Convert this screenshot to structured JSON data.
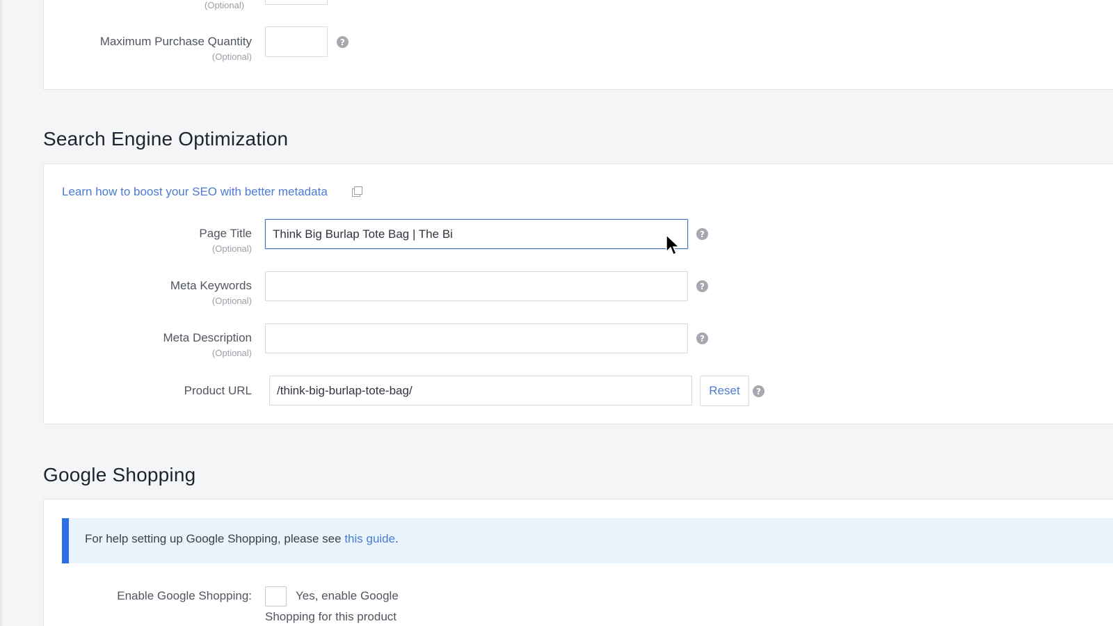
{
  "purchase": {
    "top_optional": "(Optional)",
    "max_qty_label": "Maximum Purchase Quantity",
    "max_qty_optional": "(Optional)",
    "max_qty_value": ""
  },
  "seo": {
    "title": "Search Engine Optimization",
    "learn_link": "Learn how to boost your SEO with better metadata",
    "page_title_label": "Page Title",
    "page_title_optional": "(Optional)",
    "page_title_value": "Think Big Burlap Tote Bag | The Bi",
    "meta_keywords_label": "Meta Keywords",
    "meta_keywords_optional": "(Optional)",
    "meta_keywords_value": "",
    "meta_description_label": "Meta Description",
    "meta_description_optional": "(Optional)",
    "meta_description_value": "",
    "product_url_label": "Product URL",
    "product_url_value": "/think-big-burlap-tote-bag/",
    "reset_label": "Reset",
    "help_glyph": "?"
  },
  "google": {
    "title": "Google Shopping",
    "info_prefix": "For help setting up Google Shopping, please see ",
    "info_link": "this guide",
    "info_suffix": ".",
    "enable_label": "Enable Google Shopping:",
    "enable_checkbox_line1": "Yes, enable Google",
    "enable_checkbox_line2": "Shopping for this product"
  }
}
